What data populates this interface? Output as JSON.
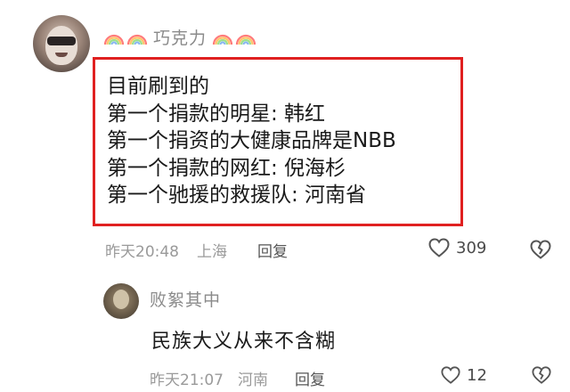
{
  "main_comment": {
    "username": "巧克力",
    "content_lines": [
      "目前刷到的",
      "第一个捐款的明星: 韩红",
      "第一个捐资的大健康品牌是NBB",
      "第一个捐款的网红: 倪海杉",
      "第一个驰援的救援队: 河南省"
    ],
    "time": "昨天20:48",
    "location": "上海",
    "reply_label": "回复",
    "like_count": "309",
    "highlight_color": "#e02020"
  },
  "reply_comment": {
    "username": "败絮其中",
    "content": "民族大义从来不含糊",
    "time": "昨天21:07",
    "location": "河南",
    "reply_label": "回复",
    "like_count": "12"
  },
  "icons": {
    "badge": "rainbow-icon",
    "like": "heart-outline-icon",
    "dislike": "broken-heart-icon"
  }
}
